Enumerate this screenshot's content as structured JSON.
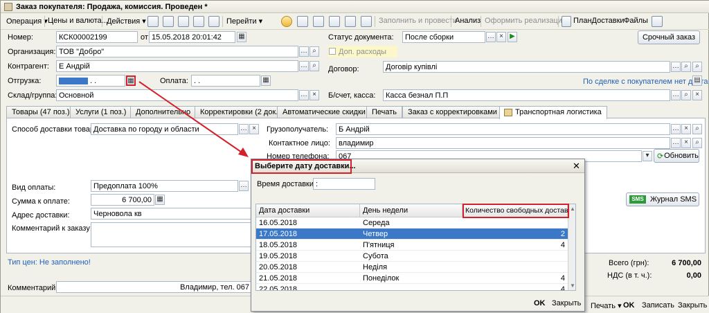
{
  "window": {
    "title": "Заказ покупателя: Продажа, комиссия. Проведен *"
  },
  "toolbar": {
    "operation": "Операция ▾",
    "prices": "Цены и валюта...",
    "actions": "Действия ▾",
    "goto": "Перейти ▾",
    "fill_post": "Заполнить и провести",
    "analysis": "Анализ",
    "make_sale": "Оформить реализацию",
    "delivery_plan": "ПланДоставки",
    "files": "Файлы"
  },
  "header": {
    "number_label": "Номер:",
    "number_value": "КСК00002199",
    "date_from_label": "от:",
    "date_value": "15.05.2018 20:01:42",
    "org_label": "Организация:",
    "org_value": "ТОВ \"Добро\"",
    "counterparty_label": "Контрагент:",
    "counterparty_value": "Е            Андрій",
    "shipment_label": "Отгрузка:",
    "shipment_value": "  .  .",
    "payment_label": "Оплата:",
    "payment_value": "  .  .",
    "warehouse_label": "Склад/группа:",
    "warehouse_value": "Основной",
    "doc_status_label": "Статус документа:",
    "doc_status_value": "После сборки",
    "extra_costs_label": "Доп. расходы",
    "contract_label": "Договор:",
    "contract_value": "Договір купівлі",
    "deal_link": "По сделке с покупателем нет долга",
    "account_label": "Б/счет, касса:",
    "account_value": "Касса безнал                    П.П",
    "urgent_button": "Срочный заказ"
  },
  "tabs": [
    {
      "label": "Товары (47 поз.)"
    },
    {
      "label": "Услуги (1 поз.)"
    },
    {
      "label": "Дополнительно"
    },
    {
      "label": "Корректировки (2 док.)"
    },
    {
      "label": "Автоматические скидки"
    },
    {
      "label": "Печать"
    },
    {
      "label": "Заказ с корректировками"
    },
    {
      "label": "Транспортная логистика"
    }
  ],
  "logistics": {
    "delivery_method_label": "Способ доставки товар...",
    "delivery_method_value": "Доставка по городу и области",
    "consignee_label": "Грузополучатель:",
    "consignee_value": "Б           Андрій",
    "contact_label": "Контактное лицо:",
    "contact_value": "владимир",
    "phone_label": "Номер телефона:",
    "phone_value": "067",
    "refresh_button": "Обновить",
    "payment_type_label": "Вид оплаты:",
    "payment_type_value": "Предоплата 100%",
    "pay_amount_label": "Сумма к оплате:",
    "pay_amount_value": "6 700,00",
    "address_label": "Адрес доставки:",
    "address_value": "Черновола        кв",
    "order_comment_label": "Комментарий к заказу:",
    "sms_badge": "SMS",
    "sms_journal": "Журнал SMS"
  },
  "footer": {
    "price_type": "Тип цен: Не заполнено!",
    "total_label": "Всего (грн):",
    "total_value": "6 700,00",
    "vat_label": "НДС (в т. ч.):",
    "vat_value": "0,00",
    "comment_label": "Комментарий:",
    "comment_value": "Владимир, тел. 067",
    "print_button": "Печать ▾",
    "ok_button": "OK",
    "save_button": "Записать",
    "close_button": "Закрыть"
  },
  "dialog": {
    "title": "Выберите дату доставки...",
    "time_label": "Время доставки:",
    "time_value": "  :",
    "columns": [
      "Дата доставки",
      "День недели",
      "Количество свободных доставок"
    ],
    "rows": [
      {
        "date": "16.05.2018",
        "day": "Середа",
        "count": ""
      },
      {
        "date": "17.05.2018",
        "day": "Четвер",
        "count": "2"
      },
      {
        "date": "18.05.2018",
        "day": "П'ятниця",
        "count": "4"
      },
      {
        "date": "19.05.2018",
        "day": "Субота",
        "count": ""
      },
      {
        "date": "20.05.2018",
        "day": "Неділя",
        "count": ""
      },
      {
        "date": "21.05.2018",
        "day": "Понеділок",
        "count": "4"
      },
      {
        "date": "22.05.2018",
        "day": "",
        "count": "4"
      }
    ],
    "selected_row": 1,
    "ok_button": "OK",
    "close_button": "Закрыть"
  },
  "colors": {
    "selection": "#3c78c8",
    "highlight_red": "#d3202a",
    "link_blue": "#1f5fb5",
    "window_bg": "#f1f0e9"
  }
}
